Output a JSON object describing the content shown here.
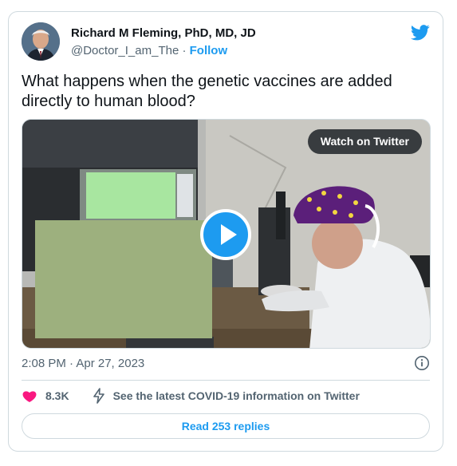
{
  "author": {
    "name": "Richard M Fleming, PhD, MD, JD",
    "handle": "@Doctor_I_am_The",
    "separator": " · ",
    "follow_label": "Follow"
  },
  "tweet": {
    "text": "What happens when the genetic vaccines are added directly to human blood?",
    "timestamp": "2:08 PM · Apr 27, 2023"
  },
  "media": {
    "watch_label": "Watch on Twitter",
    "play_icon": "play-icon"
  },
  "actions": {
    "likes": "8.3K",
    "covid_info": "See the latest COVID-19 information on Twitter"
  },
  "replies": {
    "label": "Read 253 replies"
  },
  "colors": {
    "accent": "#1d9bf0",
    "heart": "#f91880",
    "muted_text": "#536471",
    "border": "#cfd9de"
  },
  "icons": [
    "twitter-bird-icon",
    "info-icon",
    "heart-icon",
    "lightning-bolt-icon",
    "play-icon"
  ]
}
